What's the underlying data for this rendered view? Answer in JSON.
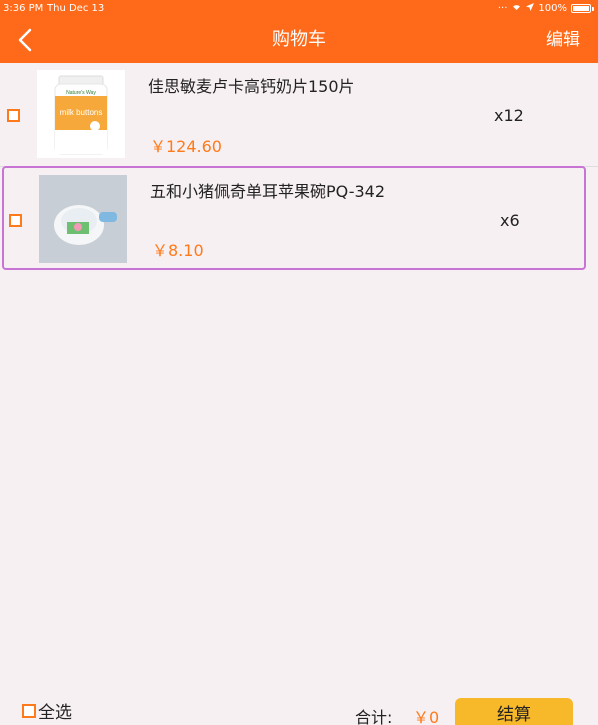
{
  "status_bar": {
    "time": "3:36 PM",
    "date": "Thu Dec 13",
    "battery": "100%"
  },
  "nav": {
    "title": "购物车",
    "edit_label": "编辑"
  },
  "cart_items": [
    {
      "title": "佳思敏麦卢卡高钙奶片150片",
      "price": "￥124.60",
      "quantity": "x12",
      "image_brand": "Nature's Way",
      "image_product": "milk buttons"
    },
    {
      "title": "五和小猪佩奇单耳苹果碗PQ-342",
      "price": "￥8.10",
      "quantity": "x6"
    }
  ],
  "bottom_bar": {
    "select_all_label": "全选",
    "total_label": "合计:",
    "total_value": "￥0",
    "checkout_label": "结算"
  },
  "colors": {
    "primary": "#ff6a1a",
    "price": "#ff7a1a",
    "checkout": "#f7b82a",
    "selection_outline": "#c774d4",
    "background": "#f7f0f2"
  }
}
